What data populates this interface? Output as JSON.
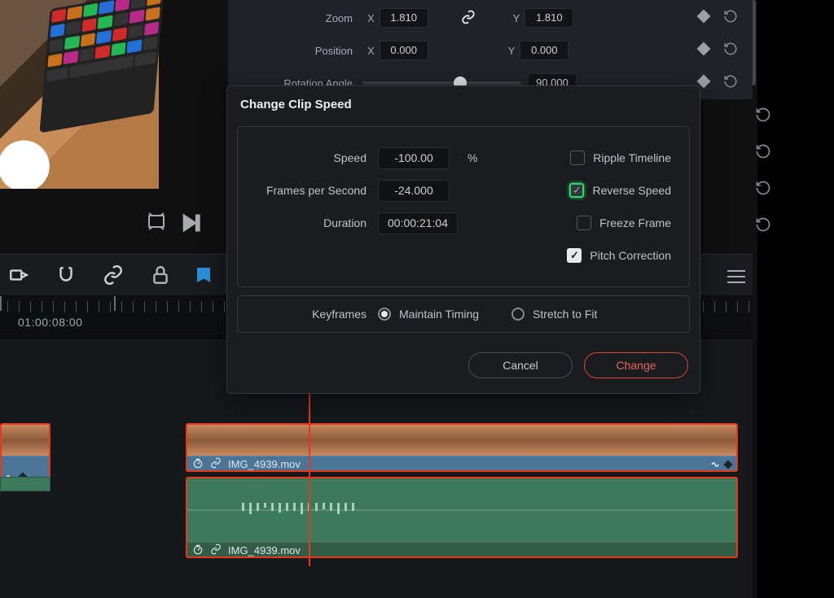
{
  "inspector": {
    "zoom_label": "Zoom",
    "zoom_x": "1.810",
    "zoom_y": "1.810",
    "axis_x": "X",
    "axis_y": "Y",
    "position_label": "Position",
    "pos_x": "0.000",
    "pos_y": "0.000",
    "rotation_label": "Rotation Angle",
    "rotation_val": "90.000"
  },
  "ruler": {
    "timecode_a": "01:00:08:00"
  },
  "clip": {
    "video_name": "IMG_4939.mov",
    "audio_name": "IMG_4939.mov"
  },
  "modal": {
    "title": "Change Clip Speed",
    "speed_label": "Speed",
    "speed_val": "-100.00",
    "speed_unit": "%",
    "fps_label": "Frames per Second",
    "fps_val": "-24.000",
    "duration_label": "Duration",
    "duration_val": "00:00:21:04",
    "ripple_label": "Ripple Timeline",
    "reverse_label": "Reverse Speed",
    "freeze_label": "Freeze Frame",
    "pitch_label": "Pitch Correction",
    "keyframes_label": "Keyframes",
    "maintain_label": "Maintain Timing",
    "stretch_label": "Stretch to Fit",
    "cancel": "Cancel",
    "change": "Change"
  }
}
